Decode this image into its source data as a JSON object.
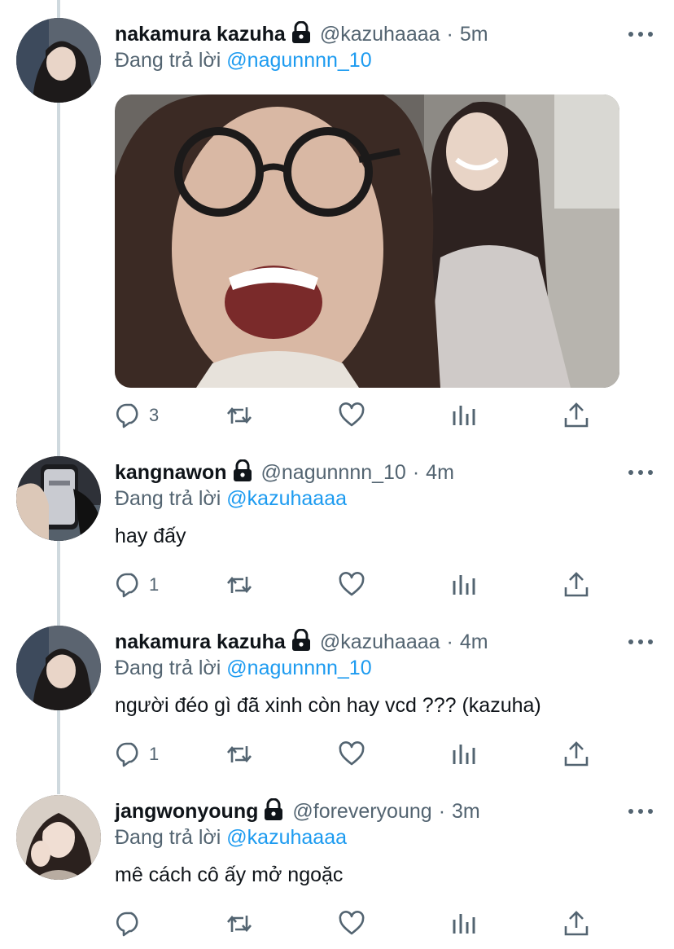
{
  "reply_prefix": "Đang trả lời",
  "tweets": [
    {
      "name": "nakamura kazuha",
      "handle": "@kazuhaaaa",
      "time": "5m",
      "reply_to": "@nagunnnn_10",
      "text": "",
      "replies": "3"
    },
    {
      "name": "kangnawon",
      "handle": "@nagunnnn_10",
      "time": "4m",
      "reply_to": "@kazuhaaaa",
      "text": "hay đấy",
      "replies": "1"
    },
    {
      "name": "nakamura kazuha",
      "handle": "@kazuhaaaa",
      "time": "4m",
      "reply_to": "@nagunnnn_10",
      "text": "người đéo gì đã xinh còn hay vcd ??? (kazuha)",
      "replies": "1"
    },
    {
      "name": "jangwonyoung",
      "handle": "@foreveryoung",
      "time": "3m",
      "reply_to": "@kazuhaaaa",
      "text": "mê cách cô ấy mở ngoặc",
      "replies": ""
    }
  ],
  "icons": {
    "reply": "speech-bubble-icon",
    "retweet": "retweet-icon",
    "like": "heart-icon",
    "analytics": "bar-chart-icon",
    "share": "share-upload-icon",
    "lock": "lock-icon",
    "more": "more-dots-icon"
  },
  "colors": {
    "link": "#1d9bf0",
    "secondary_text": "#536471",
    "thread_line": "#cfd9de"
  }
}
